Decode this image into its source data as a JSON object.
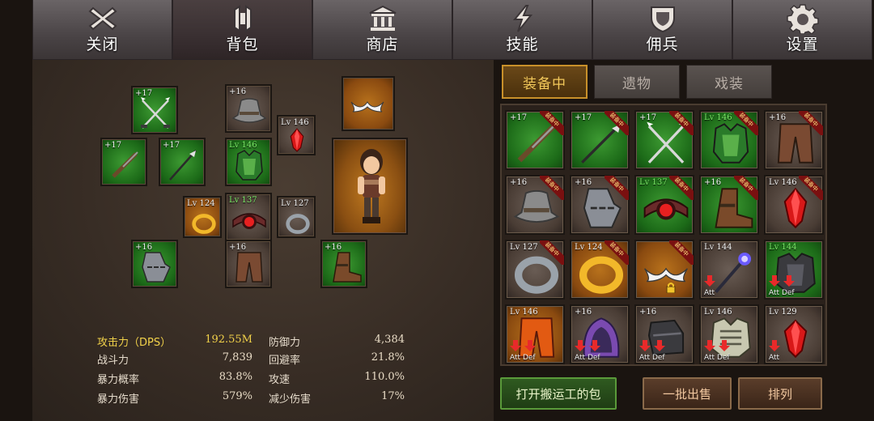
{
  "menu": [
    {
      "label": "关闭",
      "icon": "close-icon"
    },
    {
      "label": "背包",
      "icon": "backpack-icon"
    },
    {
      "label": "商店",
      "icon": "shop-icon"
    },
    {
      "label": "技能",
      "icon": "skill-icon"
    },
    {
      "label": "佣兵",
      "icon": "mercenary-icon"
    },
    {
      "label": "设置",
      "icon": "gear-icon"
    }
  ],
  "equipment": {
    "slots": [
      {
        "label": "+17",
        "item": "crossed-spears",
        "quality": "green"
      },
      {
        "label": "+16",
        "item": "hat",
        "quality": "gray"
      },
      {
        "label": "Lv 146",
        "item": "red-gem-amulet",
        "quality": "gray"
      },
      {
        "label": "+17",
        "item": "rifle",
        "quality": "green"
      },
      {
        "label": "+17",
        "item": "spear",
        "quality": "green"
      },
      {
        "label": "Lv 146",
        "item": "green-armor",
        "quality": "green"
      },
      {
        "label": "Lv 124",
        "item": "gold-ring",
        "quality": "orange"
      },
      {
        "label": "Lv 137",
        "item": "red-orb-belt",
        "quality": "gray"
      },
      {
        "label": "Lv 127",
        "item": "steel-ring",
        "quality": "gray"
      },
      {
        "label": "+16",
        "item": "gauntlet",
        "quality": "green"
      },
      {
        "label": "+16",
        "item": "pants",
        "quality": "gray"
      },
      {
        "label": "+16",
        "item": "boots",
        "quality": "green"
      },
      {
        "label": "",
        "item": "white-mustache",
        "quality": "orange"
      }
    ]
  },
  "stats": {
    "left": [
      {
        "name": "攻击力（DPS）",
        "value": "192.55M",
        "highlight": true
      },
      {
        "name": "战斗力",
        "value": "7,839"
      },
      {
        "name": "暴力概率",
        "value": "83.8%"
      },
      {
        "name": "暴力伤害",
        "value": "579%"
      }
    ],
    "right": [
      {
        "name": "防御力",
        "value": "4,384"
      },
      {
        "name": "回避率",
        "value": "21.8%"
      },
      {
        "name": "攻速",
        "value": "110.0%"
      },
      {
        "name": "减少伤害",
        "value": "17%"
      }
    ]
  },
  "tabs": [
    {
      "label": "装备中",
      "active": true
    },
    {
      "label": "遗物",
      "active": false
    },
    {
      "label": "戏装",
      "active": false
    }
  ],
  "inventory": {
    "equipped_tag": "装备中",
    "att": "Att",
    "def": "Def",
    "items": [
      {
        "label": "+17",
        "item": "rifle",
        "quality": "green",
        "equipped": true
      },
      {
        "label": "+17",
        "item": "spear",
        "quality": "green",
        "equipped": true
      },
      {
        "label": "+17",
        "item": "crossed-spears",
        "quality": "green",
        "equipped": true
      },
      {
        "label": "Lv 146",
        "item": "green-armor",
        "quality": "green",
        "equipped": true
      },
      {
        "label": "+16",
        "item": "pants",
        "quality": "gray",
        "equipped": true
      },
      {
        "label": "+16",
        "item": "hat",
        "quality": "gray",
        "equipped": true
      },
      {
        "label": "+16",
        "item": "gauntlet",
        "quality": "green",
        "equipped": true
      },
      {
        "label": "Lv 137",
        "item": "red-orb-belt",
        "quality": "gray",
        "equipped": true
      },
      {
        "label": "+16",
        "item": "boots",
        "quality": "green",
        "equipped": true
      },
      {
        "label": "Lv 146",
        "item": "red-gem-amulet",
        "quality": "gray",
        "equipped": true
      },
      {
        "label": "Lv 127",
        "item": "steel-ring",
        "quality": "gray",
        "equipped": true
      },
      {
        "label": "Lv 124",
        "item": "gold-ring",
        "quality": "orange",
        "equipped": true
      },
      {
        "label": "",
        "item": "white-mustache",
        "quality": "orange",
        "equipped": true,
        "locked": true
      },
      {
        "label": "Lv 144",
        "item": "staff",
        "quality": "gray",
        "att": true
      },
      {
        "label": "Lv 144",
        "item": "dark-armor",
        "quality": "green",
        "att": true,
        "def": true
      },
      {
        "label": "Lv 146",
        "item": "orange-pants",
        "quality": "orange",
        "att": true,
        "def": true
      },
      {
        "label": "+16",
        "item": "purple-hood",
        "quality": "gray",
        "att": true,
        "def": true
      },
      {
        "label": "+16",
        "item": "black-gauntlet",
        "quality": "gray",
        "att": true,
        "def": true
      },
      {
        "label": "Lv 146",
        "item": "bone-armor",
        "quality": "gray",
        "att": true,
        "def": true
      },
      {
        "label": "Lv 129",
        "item": "red-gem-amulet",
        "quality": "gray",
        "att": true
      }
    ]
  },
  "buttons": {
    "open_porter": "打开搬运工的包",
    "bulk_sell": "一批出售",
    "sort": "排列"
  }
}
